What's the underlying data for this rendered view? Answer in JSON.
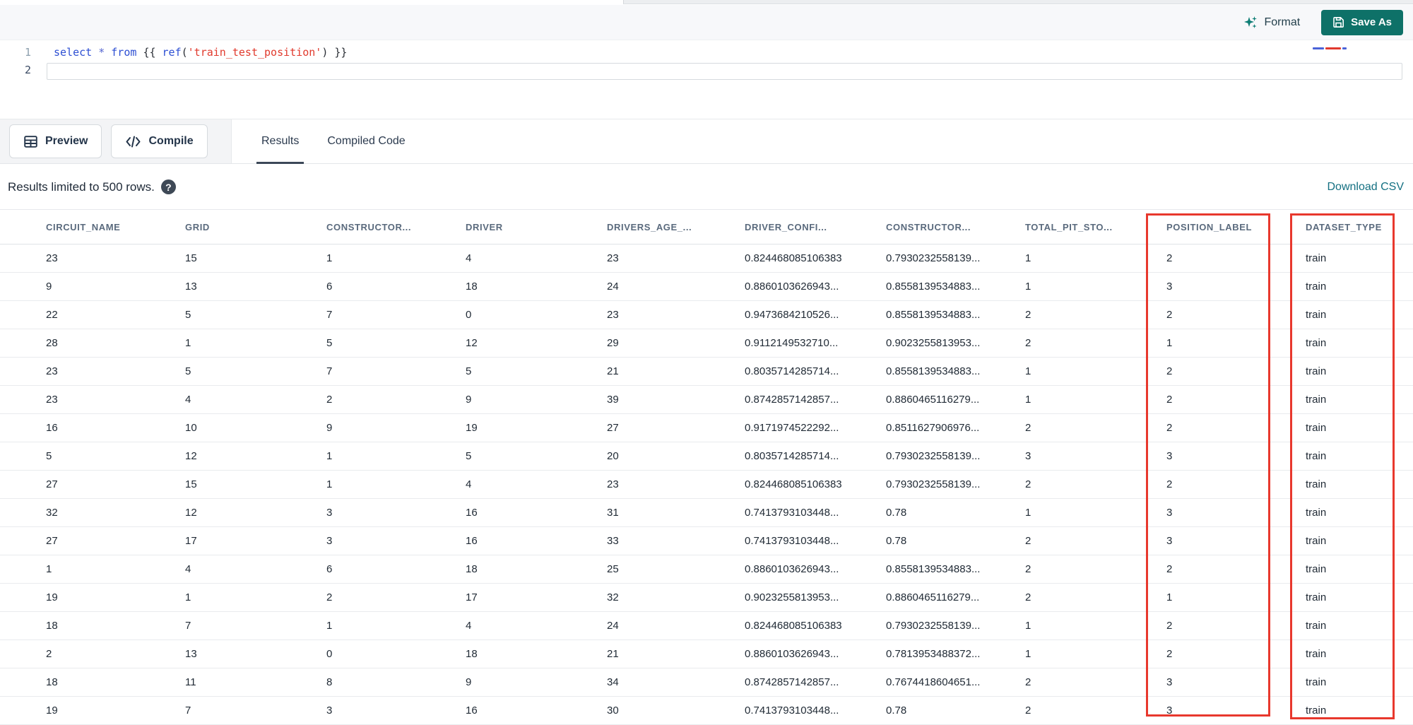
{
  "colors": {
    "accent_teal": "#0e7168",
    "link_teal": "#147082",
    "annotation_red": "#e8382d",
    "keyword_blue": "#2d4fd3",
    "string_red": "#e13a2d"
  },
  "toolbar": {
    "format_label": "Format",
    "save_as_label": "Save As"
  },
  "editor": {
    "line1_number": "1",
    "line2_number": "2",
    "code": {
      "kw_select": "select",
      "star": "*",
      "kw_from": "from",
      "brace_open": "{{",
      "fn_ref": "ref",
      "paren_open": "(",
      "string": "'train_test_position'",
      "paren_close": ")",
      "brace_close": "}}"
    }
  },
  "actions": {
    "preview_label": "Preview",
    "compile_label": "Compile"
  },
  "tabs": [
    {
      "label": "Results",
      "active": true
    },
    {
      "label": "Compiled Code",
      "active": false
    }
  ],
  "results_bar": {
    "limit_text": "Results limited to 500 rows.",
    "help_glyph": "?",
    "download_label": "Download CSV"
  },
  "table": {
    "columns": [
      "CIRCUIT_NAME",
      "GRID",
      "CONSTRUCTOR...",
      "DRIVER",
      "DRIVERS_AGE_...",
      "DRIVER_CONFI...",
      "CONSTRUCTOR...",
      "TOTAL_PIT_STO...",
      "POSITION_LABEL",
      "DATASET_TYPE"
    ],
    "highlighted_columns": [
      "POSITION_LABEL",
      "DATASET_TYPE"
    ],
    "rows": [
      [
        "23",
        "15",
        "1",
        "4",
        "23",
        "0.824468085106383",
        "0.7930232558139...",
        "1",
        "2",
        "train"
      ],
      [
        "9",
        "13",
        "6",
        "18",
        "24",
        "0.8860103626943...",
        "0.8558139534883...",
        "1",
        "3",
        "train"
      ],
      [
        "22",
        "5",
        "7",
        "0",
        "23",
        "0.9473684210526...",
        "0.8558139534883...",
        "2",
        "2",
        "train"
      ],
      [
        "28",
        "1",
        "5",
        "12",
        "29",
        "0.9112149532710...",
        "0.9023255813953...",
        "2",
        "1",
        "train"
      ],
      [
        "23",
        "5",
        "7",
        "5",
        "21",
        "0.8035714285714...",
        "0.8558139534883...",
        "1",
        "2",
        "train"
      ],
      [
        "23",
        "4",
        "2",
        "9",
        "39",
        "0.8742857142857...",
        "0.8860465116279...",
        "1",
        "2",
        "train"
      ],
      [
        "16",
        "10",
        "9",
        "19",
        "27",
        "0.9171974522292...",
        "0.8511627906976...",
        "2",
        "2",
        "train"
      ],
      [
        "5",
        "12",
        "1",
        "5",
        "20",
        "0.8035714285714...",
        "0.7930232558139...",
        "3",
        "3",
        "train"
      ],
      [
        "27",
        "15",
        "1",
        "4",
        "23",
        "0.824468085106383",
        "0.7930232558139...",
        "2",
        "2",
        "train"
      ],
      [
        "32",
        "12",
        "3",
        "16",
        "31",
        "0.7413793103448...",
        "0.78",
        "1",
        "3",
        "train"
      ],
      [
        "27",
        "17",
        "3",
        "16",
        "33",
        "0.7413793103448...",
        "0.78",
        "2",
        "3",
        "train"
      ],
      [
        "1",
        "4",
        "6",
        "18",
        "25",
        "0.8860103626943...",
        "0.8558139534883...",
        "2",
        "2",
        "train"
      ],
      [
        "19",
        "1",
        "2",
        "17",
        "32",
        "0.9023255813953...",
        "0.8860465116279...",
        "2",
        "1",
        "train"
      ],
      [
        "18",
        "7",
        "1",
        "4",
        "24",
        "0.824468085106383",
        "0.7930232558139...",
        "1",
        "2",
        "train"
      ],
      [
        "2",
        "13",
        "0",
        "18",
        "21",
        "0.8860103626943...",
        "0.7813953488372...",
        "1",
        "2",
        "train"
      ],
      [
        "18",
        "11",
        "8",
        "9",
        "34",
        "0.8742857142857...",
        "0.7674418604651...",
        "2",
        "3",
        "train"
      ],
      [
        "19",
        "7",
        "3",
        "16",
        "30",
        "0.7413793103448...",
        "0.78",
        "2",
        "3",
        "train"
      ]
    ]
  }
}
